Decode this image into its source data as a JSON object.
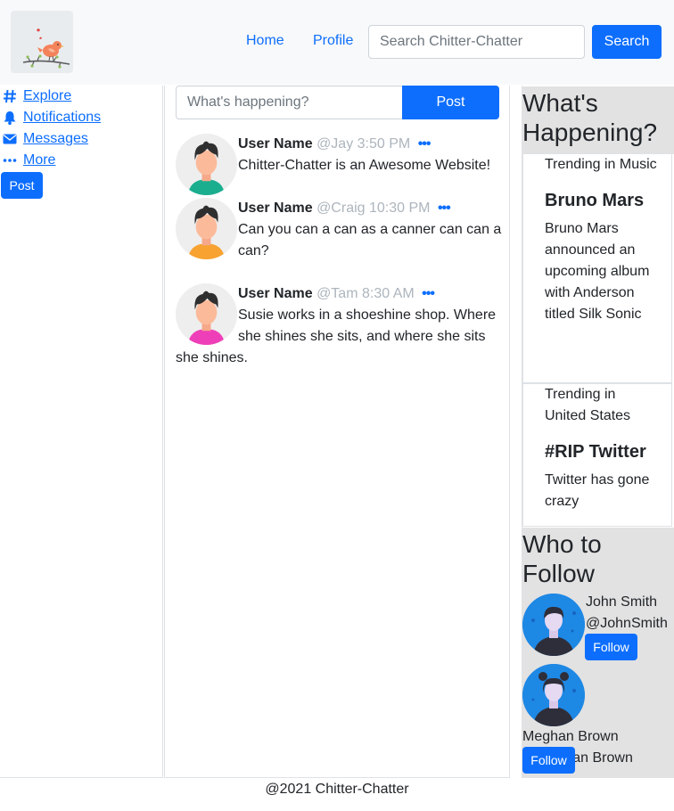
{
  "nav": {
    "home": "Home",
    "profile": "Profile",
    "search_placeholder": "Search Chitter-Chatter",
    "search_button": "Search"
  },
  "sidebar": {
    "items": [
      {
        "label": "Explore",
        "icon": "hashtag-icon"
      },
      {
        "label": "Notifications",
        "icon": "bell-icon"
      },
      {
        "label": "Messages",
        "icon": "envelope-icon"
      },
      {
        "label": "More",
        "icon": "ellipsis-icon"
      }
    ],
    "post_button": "Post"
  },
  "compose": {
    "placeholder": "What's happening?",
    "button": "Post"
  },
  "tweets": [
    {
      "name": "User Name",
      "handle": "@Jay",
      "time": "3:50 PM",
      "text": "Chitter-Chatter is an Awesome Website!",
      "shirt": "#1aae8f"
    },
    {
      "name": "User Name",
      "handle": "@Craig",
      "time": "10:30 PM",
      "text": "Can you can a can as a canner can can a can?",
      "shirt": "#f7a231"
    },
    {
      "name": "User Name",
      "handle": "@Tam",
      "time": "8:30 AM",
      "text": "Susie works in a shoeshine shop. Where she shines she sits, and where she sits she shines.",
      "shirt": "#ef3fb8"
    }
  ],
  "trending": {
    "heading": "What's Happening?",
    "items": [
      {
        "category": "Trending in Music",
        "title": "Bruno Mars",
        "body": "Bruno Mars announced an upcoming album with Anderson titled Silk Sonic"
      },
      {
        "category": "Trending in United States",
        "title": "#RIP Twitter",
        "body": "Twitter has gone crazy"
      }
    ]
  },
  "who_to_follow": {
    "heading": "Who to Follow",
    "people": [
      {
        "name": "John Smith",
        "handle": "@JohnSmith",
        "button": "Follow"
      },
      {
        "name": "Meghan Brown",
        "handle": "@Meghan Brown",
        "button": "Follow"
      }
    ]
  },
  "footer": "@2021 Chitter-Chatter",
  "colors": {
    "primary": "#0d6efd",
    "navbar_bg": "#f8f9fa",
    "section_bg": "#e2e2e2",
    "muted": "#adb5bd"
  }
}
